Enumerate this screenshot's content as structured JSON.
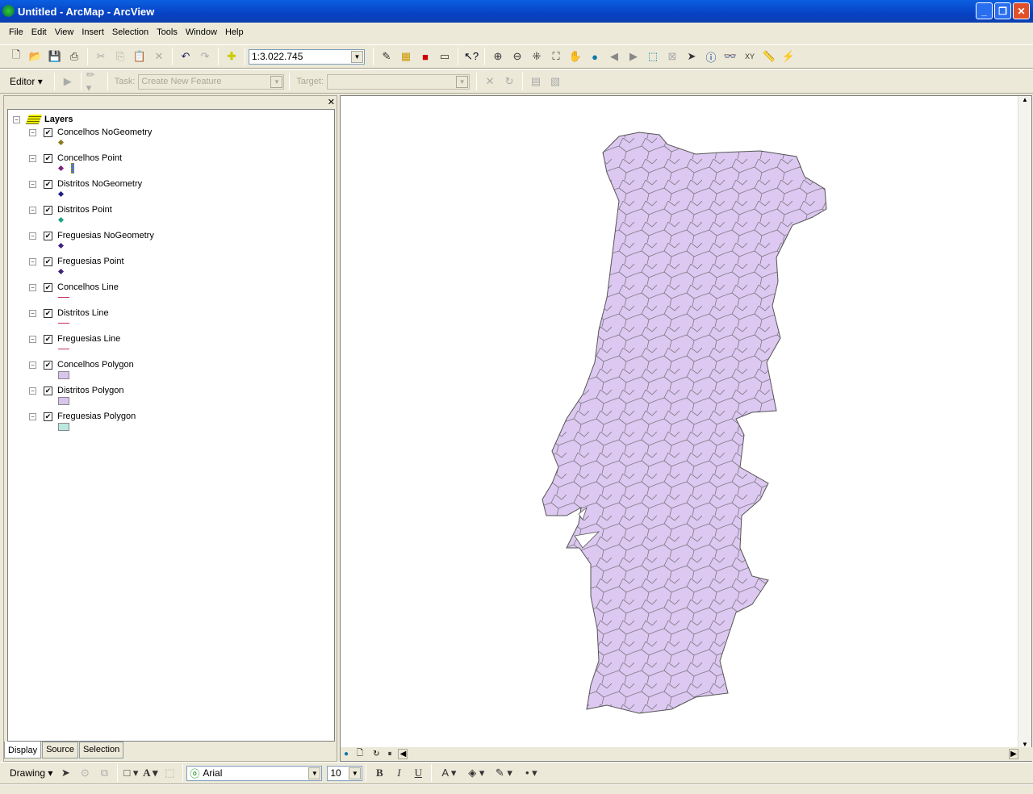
{
  "window": {
    "title": "Untitled - ArcMap - ArcView"
  },
  "menu": [
    "File",
    "Edit",
    "View",
    "Insert",
    "Selection",
    "Tools",
    "Window",
    "Help"
  ],
  "standard_toolbar": {
    "scale": "1:3.022.745",
    "icons": [
      "new-icon",
      "open-icon",
      "save-icon",
      "print-icon",
      "cut-icon",
      "copy-icon",
      "paste-icon",
      "delete-icon",
      "undo-icon",
      "redo-icon",
      "add-data-icon"
    ]
  },
  "editor_toolbar": {
    "editor_label": "Editor",
    "task_label": "Task:",
    "task_value": "Create New Feature",
    "target_label": "Target:",
    "target_value": ""
  },
  "toc": {
    "root": "Layers",
    "layers": [
      {
        "name": "Concelhos NoGeometry",
        "symbol": "point",
        "color": "#8a7a20"
      },
      {
        "name": "Concelhos Point",
        "symbol": "point",
        "color": "#802080"
      },
      {
        "name": "Distritos NoGeometry",
        "symbol": "point",
        "color": "#202080"
      },
      {
        "name": "Distritos Point",
        "symbol": "point",
        "color": "#20a080"
      },
      {
        "name": "Freguesias NoGeometry",
        "symbol": "point",
        "color": "#402080"
      },
      {
        "name": "Freguesias Point",
        "symbol": "point",
        "color": "#402080"
      },
      {
        "name": "Concelhos Line",
        "symbol": "line",
        "color": "#c03050"
      },
      {
        "name": "Distritos Line",
        "symbol": "line",
        "color": "#c03050"
      },
      {
        "name": "Freguesias Line",
        "symbol": "line",
        "color": "#c03050"
      },
      {
        "name": "Concelhos Polygon",
        "symbol": "polygon",
        "color": "#d8c4ec"
      },
      {
        "name": "Distritos Polygon",
        "symbol": "polygon",
        "color": "#d8c4ec"
      },
      {
        "name": "Freguesias Polygon",
        "symbol": "polygon",
        "color": "#b8e8e0"
      }
    ],
    "tabs": [
      "Display",
      "Source",
      "Selection"
    ]
  },
  "map": {
    "fill": "#dcc8f0",
    "outline": "#555555"
  },
  "drawing_toolbar": {
    "drawing_label": "Drawing",
    "font": "Arial",
    "size": "10",
    "bold": "B",
    "italic": "I",
    "underline": "U"
  }
}
